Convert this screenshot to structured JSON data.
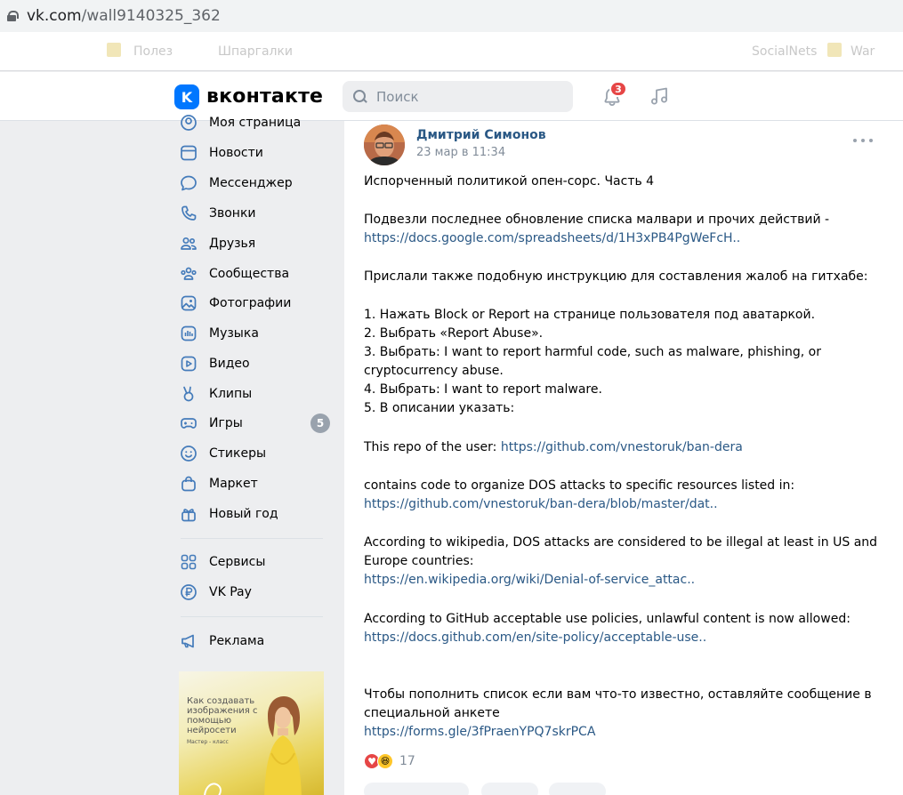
{
  "browser": {
    "url_host": "vk.com",
    "url_path": "/wall9140325_362",
    "bookmarks": [
      "Полез",
      "Шпаргалки",
      "SocialNets",
      "War"
    ]
  },
  "header": {
    "logo_letter": "K",
    "brand": "вконтакте",
    "search_placeholder": "Поиск",
    "notifications_count": "3"
  },
  "menu": {
    "items": [
      {
        "label": "Моя страница",
        "icon": "user-circle-icon"
      },
      {
        "label": "Новости",
        "icon": "news-icon"
      },
      {
        "label": "Мессенджер",
        "icon": "message-bubble-icon"
      },
      {
        "label": "Звонки",
        "icon": "phone-icon"
      },
      {
        "label": "Друзья",
        "icon": "friends-icon"
      },
      {
        "label": "Сообщества",
        "icon": "communities-icon"
      },
      {
        "label": "Фотографии",
        "icon": "photo-icon"
      },
      {
        "label": "Музыка",
        "icon": "music-wave-icon"
      },
      {
        "label": "Видео",
        "icon": "video-icon"
      },
      {
        "label": "Клипы",
        "icon": "clips-icon"
      },
      {
        "label": "Игры",
        "icon": "gamepad-icon",
        "counter": "5"
      },
      {
        "label": "Стикеры",
        "icon": "smile-icon"
      },
      {
        "label": "Маркет",
        "icon": "bag-icon"
      },
      {
        "label": "Новый год",
        "icon": "gift-icon"
      },
      {
        "label": "Сервисы",
        "icon": "grid-icon"
      },
      {
        "label": "VK Pay",
        "icon": "ruble-icon"
      },
      {
        "label": "Реклама",
        "icon": "megaphone-icon"
      }
    ],
    "ad": {
      "title": "Как создавать изображения с помощью нейросети",
      "subtitle": "Мастер - класс"
    }
  },
  "post": {
    "author": "Дмитрий Симонов",
    "date": "23 мар в 11:34",
    "paragraphs": {
      "p1": "Испорченный политикой опен-сорс. Часть 4",
      "p2": "Подвезли последнее обновление списка малвари и прочих действий -",
      "p2_link": "https://docs.google.com/spreadsheets/d/1H3xPB4PgWeFcH..",
      "p3": "Прислали также подобную инструкцию для составления жалоб на гитхабе:",
      "step1": "1. Нажать Block or Report на странице пользователя под аватаркой.",
      "step2": "2. Выбрать «Report Abuse».",
      "step3": "3. Выбрать: I want to report harmful code, such as malware, phishing, or cryptocurrency abuse.",
      "step4": "4. Выбрать: I want to report malware.",
      "step5": "5. В описании указать:",
      "p4": "This repo of the user: ",
      "p4_link": "https://github.com/vnestoruk/ban-dera",
      "p5": "contains code to organize DOS attacks to specific resources listed in:",
      "p5_link": "https://github.com/vnestoruk/ban-dera/blob/master/dat..",
      "p6": "According to wikipedia, DOS attacks are considered to be illegal at least in US and Europe countries:",
      "p6_link": "https://en.wikipedia.org/wiki/Denial-of-service_attac..",
      "p7": "According to GitHub acceptable use policies, unlawful content is now allowed:",
      "p7_link": "https://docs.github.com/en/site-policy/acceptable-use..",
      "p8": "Чтобы пополнить список если вам что-то известно, оставляйте сообщение в специальной анкете",
      "p8_link": "https://forms.gle/3fPraenYPQ7skrPCA"
    },
    "reactions_count": "17"
  },
  "colors": {
    "vk_blue": "#0077ff",
    "link": "#2a5885",
    "badge_red": "#e64646",
    "background": "#edeef0"
  }
}
